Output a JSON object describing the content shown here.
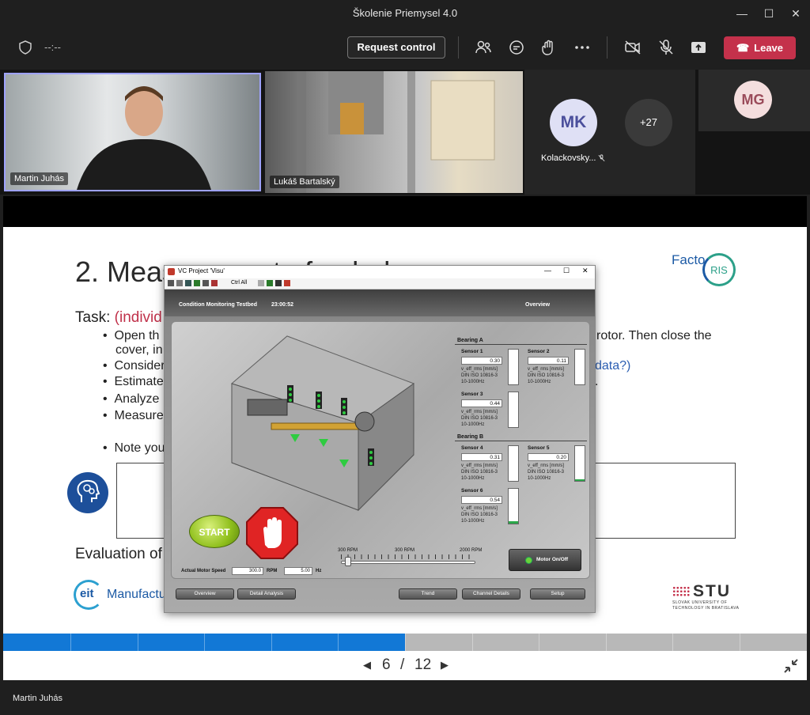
{
  "window": {
    "title": "Školenie Priemysel 4.0"
  },
  "toolbar": {
    "timer": "--:--",
    "request_control": "Request control",
    "leave": "Leave"
  },
  "participants": {
    "p1": "Martin Juhás",
    "p2": "Lukáš Bartalský",
    "mk_initials": "MK",
    "mk_name": "Kolackovsky...",
    "more": "+27",
    "mg_initials": "MG"
  },
  "slide": {
    "title": "2. Measurement of unbalance",
    "task_label": "Task:",
    "task_sub": "(individ",
    "bullets": [
      "Open th",
      "cover, in",
      "Consider",
      "Estimate",
      "Analyze",
      "Measure",
      "Note you"
    ],
    "right_fragments": [
      "rotor. Then close the",
      "data?)",
      "."
    ],
    "evaluation": "Evaluation of",
    "logo_facto": "Facto",
    "logo_ris": "RIS",
    "eit": "eit",
    "manufactu": "Manufactu",
    "stu": "STU",
    "stu_sub1": "SLOVAK UNIVERSITY OF",
    "stu_sub2": "TECHNOLOGY IN BRATISLAVA",
    "progress": 0.5
  },
  "pager": {
    "current": "6",
    "sep": "/",
    "total": "12"
  },
  "presenter": "Martin Juhás",
  "visu": {
    "title": "VC Project 'Visu'",
    "toolbar_text": "Ctrl All",
    "header_left": "Condition Monitoring Testbed",
    "header_time": "23:00:52",
    "header_right": "Overview",
    "bearing_a": "Bearing A",
    "bearing_b": "Bearing B",
    "unit1": "v_eff_rms [mm/s]",
    "unit2": "DIN ISO 10816-3",
    "unit3": "10-1000Hz",
    "sensors": [
      {
        "name": "Sensor 1",
        "value": "0.30",
        "level": 0.0
      },
      {
        "name": "Sensor 2",
        "value": "0.11",
        "level": 0.0
      },
      {
        "name": "Sensor 3",
        "value": "0.44",
        "level": 0.0
      },
      {
        "name": "Sensor 4",
        "value": "0.31",
        "level": 0.0
      },
      {
        "name": "Sensor 5",
        "value": "0.20",
        "level": 0.05
      },
      {
        "name": "Sensor 6",
        "value": "0.54",
        "level": 0.06
      }
    ],
    "start": "START",
    "rpm_min": "300 RPM",
    "rpm_mid": "300 RPM",
    "rpm_max": "2000 RPM",
    "motor_onoff": "Motor On/Off",
    "speed_label": "Actual Motor Speed",
    "speed_rpm": "300.0",
    "rpm_unit": "RPM",
    "speed_hz": "5.00",
    "hz_unit": "Hz",
    "nav": [
      "Overview",
      "Detail Analysis",
      "Trend",
      "Channel Details",
      "Setup"
    ]
  }
}
